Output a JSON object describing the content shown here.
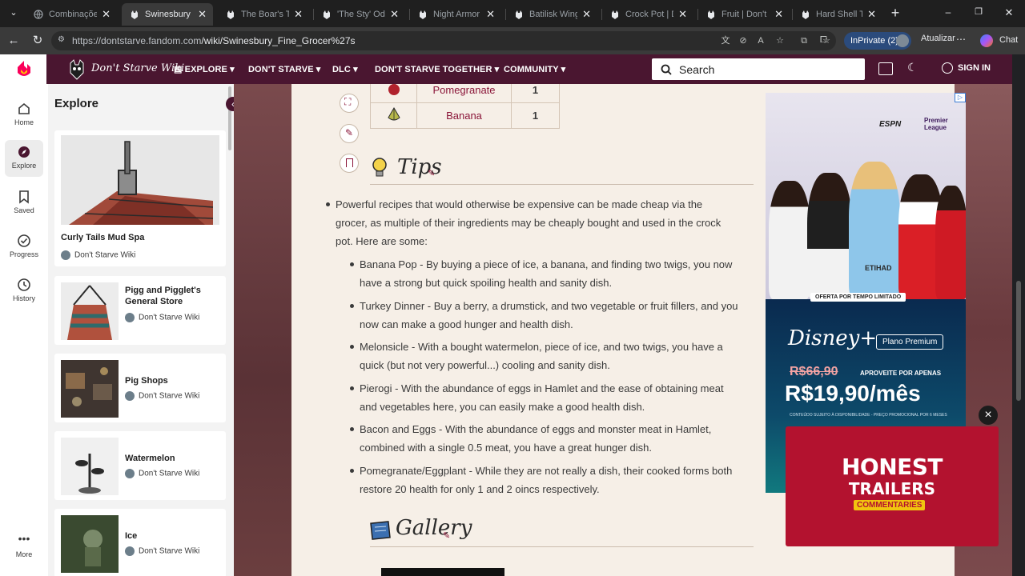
{
  "browser": {
    "tabs": [
      {
        "label": "Combinações de",
        "active": false
      },
      {
        "label": "Swinesbury Fine",
        "active": true
      },
      {
        "label": "The Boar's Tusk",
        "active": false
      },
      {
        "label": "'The Sty' Odditie",
        "active": false
      },
      {
        "label": "Night Armor | D",
        "active": false
      },
      {
        "label": "Batilisk Wing | D",
        "active": false
      },
      {
        "label": "Crock Pot | Don",
        "active": false
      },
      {
        "label": "Fruit | Don't Star",
        "active": false
      },
      {
        "label": "Hard Shell Taco",
        "active": false
      }
    ],
    "url_host": "https://dontstarve.fandom.com",
    "url_path": "/wiki/Swinesbury_Fine_Grocer%27s",
    "inprivate_label": "InPrivate (2)",
    "update_label": "Atualizar",
    "chat_label": "Chat"
  },
  "site": {
    "logo_text": "Don't Starve Wiki",
    "nav": [
      "EXPLORE",
      "DON'T STARVE",
      "DLC",
      "DON'T STARVE TOGETHER",
      "COMMUNITY"
    ],
    "search_placeholder": "Search",
    "signin_label": "SIGN IN"
  },
  "rail": {
    "items": [
      {
        "label": "Home",
        "icon": "home-icon"
      },
      {
        "label": "Explore",
        "icon": "compass-icon"
      },
      {
        "label": "Saved",
        "icon": "bookmark-icon"
      },
      {
        "label": "Progress",
        "icon": "check-circle-icon"
      },
      {
        "label": "History",
        "icon": "history-icon"
      },
      {
        "label": "More",
        "icon": "more-icon"
      }
    ]
  },
  "explore": {
    "title": "Explore",
    "cards": [
      {
        "name": "Curly Tails Mud Spa",
        "source": "Don't Starve Wiki"
      },
      {
        "name": "Pigg and Pigglet's General Store",
        "source": "Don't Starve Wiki"
      },
      {
        "name": "Pig Shops",
        "source": "Don't Starve Wiki"
      },
      {
        "name": "Watermelon",
        "source": "Don't Starve Wiki"
      },
      {
        "name": "Ice",
        "source": "Don't Starve Wiki"
      }
    ]
  },
  "article": {
    "recipe_table": [
      {
        "name": "Pomegranate",
        "qty": "1"
      },
      {
        "name": "Banana",
        "qty": "1"
      }
    ],
    "tips_heading": "Tips",
    "tips_intro": "Powerful recipes that would otherwise be expensive can be made cheap via the grocer, as multiple of their ingredients may be cheaply bought and used in the crock pot. Here are some:",
    "tips": [
      "Banana Pop - By buying a piece of ice, a banana, and finding two twigs, you now have a strong but quick spoiling health and sanity dish.",
      "Turkey Dinner - Buy a berry, a drumstick, and two vegetable or fruit fillers, and you now can make a good hunger and health dish.",
      "Melonsicle - With a bought watermelon, piece of ice, and two twigs, you have a quick (but not very powerful...) cooling and sanity dish.",
      "Pierogi - With the abundance of eggs in Hamlet and the ease of obtaining meat and vegetables here, you can easily make a good health dish.",
      "Bacon and Eggs - With the abundance of eggs and monster meat in Hamlet, combined with a single 0.5 meat, you have a great hunger dish.",
      "Pomegranate/Eggplant - While they are not really a dish, their cooked forms both restore 20 health for only 1 and 2 oincs respectively."
    ],
    "gallery_heading": "Gallery"
  },
  "ads": {
    "ad1_brand_top": "ESPN",
    "ad1_brand_league": "Premier League",
    "ad1_offer_tag": "OFERTA POR TEMPO LIMITADO",
    "ad1_disney": "Disney+",
    "ad1_plan": "Plano Premium",
    "ad1_old_price": "R$66,90",
    "ad1_promo": "APROVEITE POR APENAS",
    "ad1_new_price": "R$19,90/mês",
    "ad1_fineprint": "CONTEÚDO SUJEITO À DISPONIBILIDADE - PREÇO PROMOCIONAL POR 6 MESES",
    "ad2_line1": "HONEST",
    "ad2_line2": "TRAILERS",
    "ad2_line3": "COMMENTARIES"
  }
}
